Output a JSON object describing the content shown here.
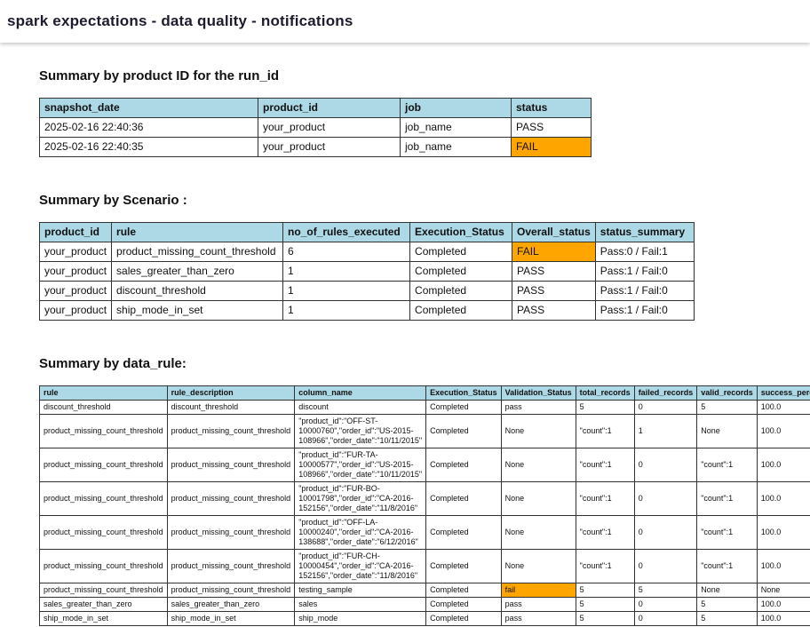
{
  "page": {
    "title": "spark expectations - data quality - notifications"
  },
  "colors": {
    "header_bg": "#ADD8E6",
    "fail_bg": "#FFA500"
  },
  "sections": [
    {
      "heading": "Summary by product ID for the run_id",
      "table": {
        "columns": [
          "snapshot_date",
          "product_id",
          "job",
          "status"
        ],
        "rows": [
          [
            "2025-02-16 22:40:36",
            "your_product",
            "job_name",
            "PASS"
          ],
          [
            "2025-02-16 22:40:35",
            "your_product",
            "job_name",
            {
              "text": "FAIL",
              "highlight": true
            }
          ]
        ]
      }
    },
    {
      "heading": "Summary by Scenario :",
      "table": {
        "columns": [
          "product_id",
          "rule",
          "no_of_rules_executed",
          "Execution_Status",
          "Overall_status",
          "status_summary"
        ],
        "rows": [
          [
            "your_product",
            "product_missing_count_threshold",
            "6",
            "Completed",
            {
              "text": "FAIL",
              "highlight": true
            },
            "Pass:0 / Fail:1"
          ],
          [
            "your_product",
            "sales_greater_than_zero",
            "1",
            "Completed",
            "PASS",
            "Pass:1 / Fail:0"
          ],
          [
            "your_product",
            "discount_threshold",
            "1",
            "Completed",
            "PASS",
            "Pass:1 / Fail:0"
          ],
          [
            "your_product",
            "ship_mode_in_set",
            "1",
            "Completed",
            "PASS",
            "Pass:1 / Fail:0"
          ]
        ]
      }
    },
    {
      "heading": "Summary by data_rule:",
      "table": {
        "columns": [
          "rule",
          "rule_description",
          "column_name",
          "Execution_Status",
          "Validation_Status",
          "total_records",
          "failed_records",
          "valid_records",
          "success_percentage"
        ],
        "rows": [
          [
            "discount_threshold",
            "discount_threshold",
            "discount",
            "Completed",
            "pass",
            "5",
            "0",
            "5",
            "100.0"
          ],
          [
            "product_missing_count_threshold",
            "product_missing_count_threshold",
            "\"product_id\":\"OFF-ST-10000760\",\"order_id\":\"US-2015-108966\",\"order_date\":\"10/11/2015\"",
            "Completed",
            "None",
            "\"count\":1",
            "1",
            "None",
            "100.0"
          ],
          [
            "product_missing_count_threshold",
            "product_missing_count_threshold",
            "\"product_id\":\"FUR-TA-10000577\",\"order_id\":\"US-2015-108966\",\"order_date\":\"10/11/2015\"",
            "Completed",
            "None",
            "\"count\":1",
            "0",
            "\"count\":1",
            "100.0"
          ],
          [
            "product_missing_count_threshold",
            "product_missing_count_threshold",
            "\"product_id\":\"FUR-BO-10001798\",\"order_id\":\"CA-2016-152156\",\"order_date\":\"11/8/2016\"",
            "Completed",
            "None",
            "\"count\":1",
            "0",
            "\"count\":1",
            "100.0"
          ],
          [
            "product_missing_count_threshold",
            "product_missing_count_threshold",
            "\"product_id\":\"OFF-LA-10000240\",\"order_id\":\"CA-2016-138688\",\"order_date\":\"6/12/2016\"",
            "Completed",
            "None",
            "\"count\":1",
            "0",
            "\"count\":1",
            "100.0"
          ],
          [
            "product_missing_count_threshold",
            "product_missing_count_threshold",
            "\"product_id\":\"FUR-CH-10000454\",\"order_id\":\"CA-2016-152156\",\"order_date\":\"11/8/2016\"",
            "Completed",
            "None",
            "\"count\":1",
            "0",
            "\"count\":1",
            "100.0"
          ],
          [
            "product_missing_count_threshold",
            "product_missing_count_threshold",
            "testing_sample",
            "Completed",
            {
              "text": "fail",
              "highlight": true
            },
            "5",
            "5",
            "None",
            "None"
          ],
          [
            "sales_greater_than_zero",
            "sales_greater_than_zero",
            "sales",
            "Completed",
            "pass",
            "5",
            "0",
            "5",
            "100.0"
          ],
          [
            "ship_mode_in_set",
            "ship_mode_in_set",
            "ship_mode",
            "Completed",
            "pass",
            "5",
            "0",
            "5",
            "100.0"
          ]
        ]
      }
    }
  ]
}
